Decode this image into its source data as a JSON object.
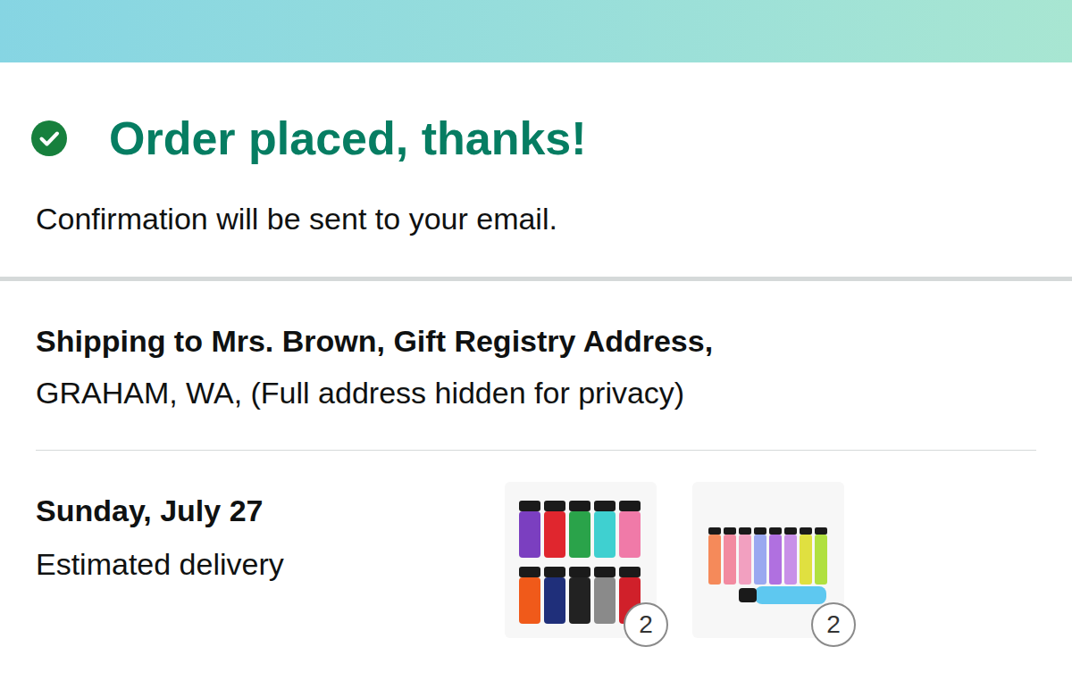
{
  "status": {
    "title": "Order placed, thanks!",
    "message": "Confirmation will be sent to your email."
  },
  "shipping": {
    "heading": "Shipping to Mrs. Brown, Gift Registry Address,",
    "address": "GRAHAM, WA, (Full address hidden for privacy)"
  },
  "delivery": {
    "date": "Sunday, July 27",
    "label": "Estimated delivery"
  },
  "items": [
    {
      "quantity": "2"
    },
    {
      "quantity": "2"
    }
  ]
}
